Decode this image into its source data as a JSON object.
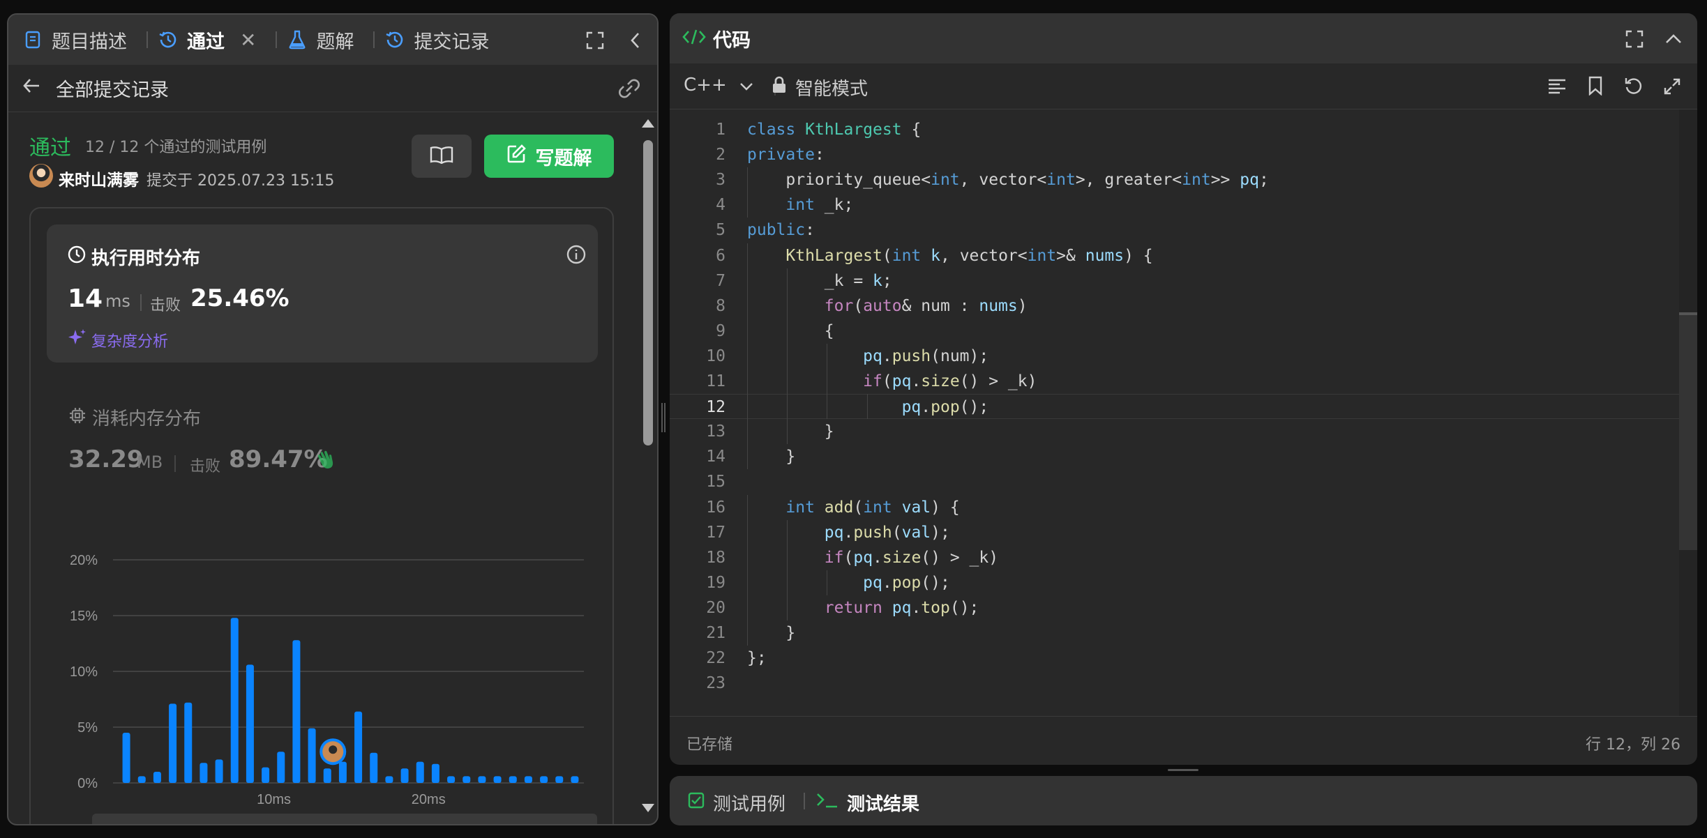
{
  "left_tabs": [
    {
      "label": "题目描述"
    },
    {
      "label": "通过"
    },
    {
      "label": "题解"
    },
    {
      "label": "提交记录"
    }
  ],
  "subheader": {
    "back_label": "全部提交记录"
  },
  "submission": {
    "status": "通过",
    "testcases": "12 / 12 个通过的测试用例",
    "user": "来时山满雾",
    "submitted_at": "提交于 2025.07.23 15:15",
    "write_solution": "写题解"
  },
  "runtime": {
    "title": "执行用时分布",
    "value": "14",
    "unit": "ms",
    "beats_label": "击败",
    "beats": "25.46%",
    "complexity": "复杂度分析"
  },
  "memory": {
    "title": "消耗内存分布",
    "value": "32.29",
    "unit": "MB",
    "beats_label": "击败",
    "beats": "89.47%"
  },
  "chart_data": {
    "type": "bar",
    "title": "",
    "xlabel": "",
    "ylabel": "",
    "ylim": [
      0,
      20
    ],
    "y_ticks": [
      "20%",
      "15%",
      "10%",
      "5%",
      "0%"
    ],
    "x_ticks": [
      "10ms",
      "20ms"
    ],
    "x_tick_positions": [
      10,
      20
    ],
    "x": [
      1,
      2,
      3,
      4,
      5,
      6,
      7,
      8,
      9,
      10,
      11,
      12,
      13,
      14,
      15,
      16,
      17,
      18,
      19,
      20,
      21,
      22,
      23,
      24,
      25,
      26,
      27,
      28,
      29,
      30
    ],
    "values": [
      4.5,
      0.6,
      1.0,
      7.1,
      7.2,
      1.8,
      2.1,
      14.8,
      10.6,
      1.4,
      2.8,
      12.8,
      4.9,
      1.3,
      1.9,
      6.4,
      2.7,
      0.6,
      1.3,
      1.9,
      1.7,
      0.6,
      0.6,
      0.6,
      0.6,
      0.6,
      0.6,
      0.6,
      0.6,
      0.6
    ],
    "highlight_x": 14,
    "bar_color": "#0a84ff",
    "grid": true
  },
  "editor": {
    "title": "代码",
    "language": "C++",
    "mode": "智能模式",
    "status_saved": "已存储",
    "cursor": "行 12，列 26",
    "active_line": 12
  },
  "code_lines": [
    "class KthLargest {",
    "private:",
    "    priority_queue<int, vector<int>, greater<int>> pq;",
    "    int _k;",
    "public:",
    "    KthLargest(int k, vector<int>& nums) {",
    "        _k = k;",
    "        for(auto& num : nums)",
    "        {",
    "            pq.push(num);",
    "            if(pq.size() > _k)",
    "                pq.pop();",
    "        }",
    "    }",
    "",
    "    int add(int val) {",
    "        pq.push(val);",
    "        if(pq.size() > _k)",
    "            pq.pop();",
    "        return pq.top();",
    "    }",
    "};",
    ""
  ],
  "line_numbers": [
    "1",
    "2",
    "3",
    "4",
    "5",
    "6",
    "7",
    "8",
    "9",
    "10",
    "11",
    "12",
    "13",
    "14",
    "15",
    "16",
    "17",
    "18",
    "19",
    "20",
    "21",
    "22",
    "23"
  ],
  "bottom_tabs": [
    {
      "label": "测试用例"
    },
    {
      "label": "测试结果"
    }
  ],
  "colors": {
    "accent_green": "#2cbb5d",
    "accent_blue": "#0a84ff",
    "purple": "#8a6cf0"
  }
}
